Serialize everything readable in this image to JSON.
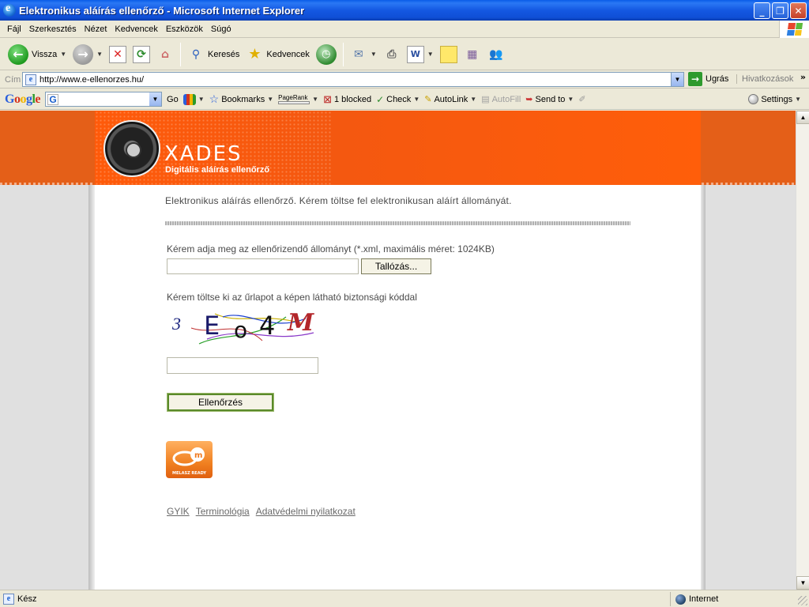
{
  "window": {
    "title": "Elektronikus aláírás ellenőrző - Microsoft Internet Explorer"
  },
  "menu": [
    "Fájl",
    "Szerkesztés",
    "Nézet",
    "Kedvencek",
    "Eszközök",
    "Súgó"
  ],
  "toolbar": {
    "back": "Vissza",
    "search": "Keresés",
    "favorites": "Kedvencek"
  },
  "address": {
    "label": "Cím",
    "url": "http://www.e-ellenorzes.hu/",
    "go": "Ugrás",
    "links": "Hivatkozások"
  },
  "google_bar": {
    "logo": "Google",
    "go": "Go",
    "bookmarks": "Bookmarks",
    "pagerank": "PageRank",
    "blocked": "1 blocked",
    "check": "Check",
    "autolink": "AutoLink",
    "autofill": "AutoFill",
    "sendto": "Send to",
    "settings": "Settings"
  },
  "page": {
    "brand": "XADES",
    "brand_sub": "Digitális aláírás ellenőrző",
    "intro": "Elektronikus aláírás ellenőrző. Kérem töltse fel elektronikusan aláírt állományát.",
    "file_label": "Kérem adja meg az ellenőrizendő állományt (*.xml, maximális méret: 1024KB)",
    "browse": "Tallózás...",
    "captcha_label": "Kérem töltse ki az űrlapot a képen látható biztonsági kóddal",
    "captcha_chars": [
      "3",
      "E",
      "o",
      "4",
      "M"
    ],
    "submit": "Ellenőrzés",
    "badge_text": "MELASZ READY",
    "footer_links": [
      "GYIK",
      "Terminológia",
      "Adatvédelmi nyilatkozat"
    ]
  },
  "status": {
    "text": "Kész",
    "zone": "Internet"
  },
  "colors": {
    "header_orange": "#ff5a0a",
    "xp_blue": "#0f4fd6"
  }
}
